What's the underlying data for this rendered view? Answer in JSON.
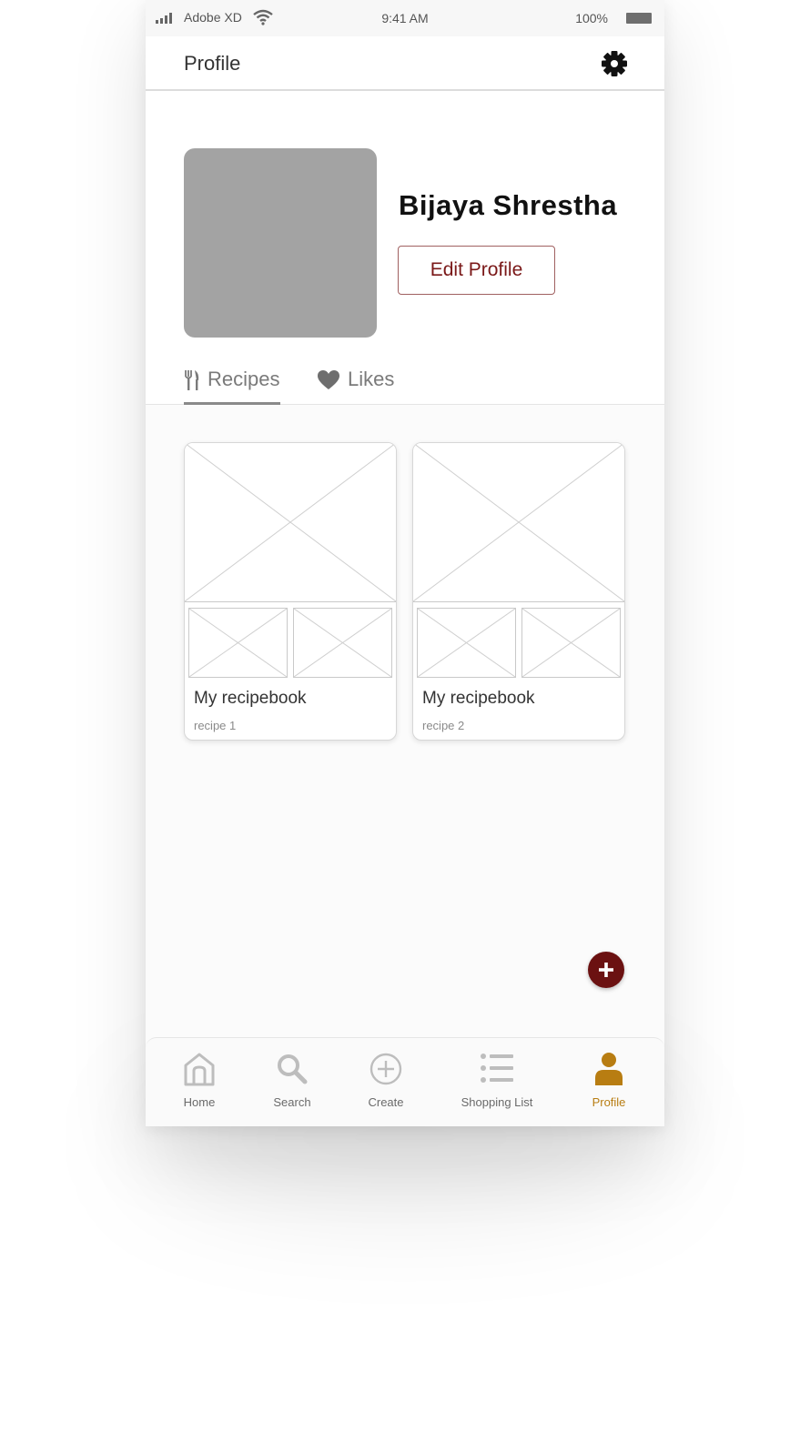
{
  "status_bar": {
    "carrier": "Adobe XD",
    "time": "9:41 AM",
    "battery": "100%"
  },
  "header": {
    "title": "Profile",
    "settings_icon": "gear-icon"
  },
  "profile": {
    "name": "Bijaya Shrestha",
    "edit_button": "Edit Profile"
  },
  "tabs": [
    {
      "label": "Recipes",
      "icon": "fork-knife-icon",
      "active": true
    },
    {
      "label": "Likes",
      "icon": "heart-icon",
      "active": false
    }
  ],
  "recipebooks": [
    {
      "title": "My recipebook",
      "subtitle": "recipe 1"
    },
    {
      "title": "My recipebook",
      "subtitle": "recipe 2"
    }
  ],
  "fab": {
    "icon": "plus-icon"
  },
  "bottom_nav": [
    {
      "label": "Home",
      "icon": "home-icon",
      "active": false
    },
    {
      "label": "Search",
      "icon": "search-icon",
      "active": false
    },
    {
      "label": "Create",
      "icon": "plus-circle-icon",
      "active": false
    },
    {
      "label": "Shopping List",
      "icon": "list-icon",
      "active": false
    },
    {
      "label": "Profile",
      "icon": "user-icon",
      "active": true
    }
  ],
  "colors": {
    "accent_dark_red": "#6b1111",
    "edit_text": "#7a1818",
    "active_nav": "#b87d12",
    "avatar_placeholder": "#a3a3a3"
  }
}
